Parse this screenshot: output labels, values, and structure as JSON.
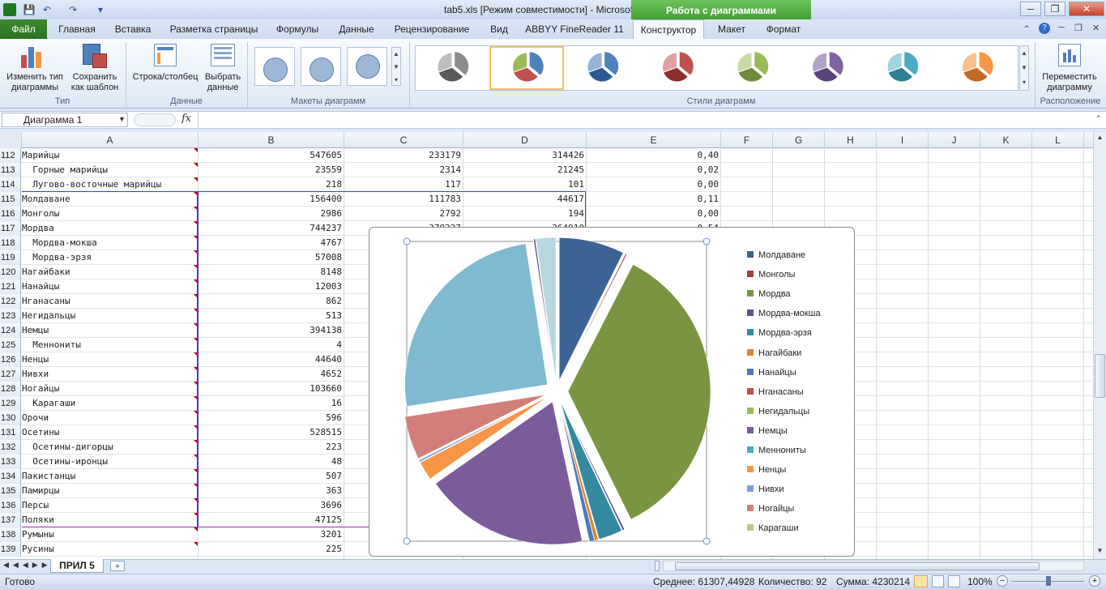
{
  "window": {
    "title": "tab5.xls  [Режим совместимости]  -  Microsoft Excel",
    "context_band": "Работа с диаграммами",
    "win_minimize": "─",
    "win_restore": "❐",
    "win_close": "✕"
  },
  "quick_access": [
    "save-icon",
    "undo-icon",
    "redo-icon",
    "customize-icon"
  ],
  "tabs": {
    "file": "Файл",
    "items": [
      "Главная",
      "Вставка",
      "Разметка страницы",
      "Формулы",
      "Данные",
      "Рецензирование",
      "Вид",
      "ABBYY FineReader 11",
      "Конструктор",
      "Макет",
      "Формат"
    ],
    "active": "Конструктор"
  },
  "ribbon": {
    "change_type": "Изменить тип\nдиаграммы",
    "save_template": "Сохранить\nкак шаблон",
    "group_type": "Тип",
    "row_col": "Строка/столбец",
    "select_data": "Выбрать\nданные",
    "group_data": "Данные",
    "group_layouts": "Макеты диаграмм",
    "group_styles": "Стили диаграмм",
    "move_chart": "Переместить\nдиаграмму",
    "group_location": "Расположение"
  },
  "formula_bar": {
    "name_box": "Диаграмма 1",
    "fx": "fx",
    "formula": ""
  },
  "columns": [
    "A",
    "B",
    "C",
    "D",
    "E",
    "F",
    "G",
    "H",
    "I",
    "J",
    "K",
    "L"
  ],
  "rows": [
    {
      "n": "112",
      "a": "Марийцы",
      "b": "547605",
      "c": "233179",
      "d": "314426",
      "e": "0,40"
    },
    {
      "n": "113",
      "a": "  Горные марийцы",
      "b": "23559",
      "c": "2314",
      "d": "21245",
      "e": "0,02"
    },
    {
      "n": "114",
      "a": "  Лугово-восточные марийцы",
      "b": "218",
      "c": "117",
      "d": "101",
      "e": "0,00"
    },
    {
      "n": "115",
      "a": "Молдаване",
      "b": "156400",
      "c": "111783",
      "d": "44617",
      "e": "0,11"
    },
    {
      "n": "116",
      "a": "Монголы",
      "b": "2986",
      "c": "2792",
      "d": "194",
      "e": "0,00"
    },
    {
      "n": "117",
      "a": "Мордва",
      "b": "744237",
      "c": "379327",
      "d": "364910",
      "e": "0,54"
    },
    {
      "n": "118",
      "a": "  Мордва-мокша",
      "b": "4767",
      "c": "",
      "d": "",
      "e": ""
    },
    {
      "n": "119",
      "a": "  Мордва-эрзя",
      "b": "57008",
      "c": "",
      "d": "",
      "e": ""
    },
    {
      "n": "120",
      "a": "Нагайбаки",
      "b": "8148",
      "c": "",
      "d": "",
      "e": ""
    },
    {
      "n": "121",
      "a": "Нанайцы",
      "b": "12003",
      "c": "",
      "d": "",
      "e": ""
    },
    {
      "n": "122",
      "a": "Нганасаны",
      "b": "862",
      "c": "",
      "d": "",
      "e": ""
    },
    {
      "n": "123",
      "a": "Негидальцы",
      "b": "513",
      "c": "",
      "d": "",
      "e": ""
    },
    {
      "n": "124",
      "a": "Немцы",
      "b": "394138",
      "c": "",
      "d": "",
      "e": ""
    },
    {
      "n": "125",
      "a": "  Меннониты",
      "b": "4",
      "c": "",
      "d": "",
      "e": ""
    },
    {
      "n": "126",
      "a": "Ненцы",
      "b": "44640",
      "c": "",
      "d": "",
      "e": ""
    },
    {
      "n": "127",
      "a": "Нивхи",
      "b": "4652",
      "c": "",
      "d": "",
      "e": ""
    },
    {
      "n": "128",
      "a": "Ногайцы",
      "b": "103660",
      "c": "",
      "d": "",
      "e": ""
    },
    {
      "n": "129",
      "a": "  Карагаши",
      "b": "16",
      "c": "",
      "d": "",
      "e": ""
    },
    {
      "n": "130",
      "a": "Орочи",
      "b": "596",
      "c": "",
      "d": "",
      "e": ""
    },
    {
      "n": "131",
      "a": "Осетины",
      "b": "528515",
      "c": "",
      "d": "",
      "e": ""
    },
    {
      "n": "132",
      "a": "  Осетины-дигорцы",
      "b": "223",
      "c": "",
      "d": "",
      "e": ""
    },
    {
      "n": "133",
      "a": "  Осетины-иронцы",
      "b": "48",
      "c": "",
      "d": "",
      "e": ""
    },
    {
      "n": "134",
      "a": "Пакистанцы",
      "b": "507",
      "c": "",
      "d": "",
      "e": ""
    },
    {
      "n": "135",
      "a": "Памирцы",
      "b": "363",
      "c": "",
      "d": "",
      "e": ""
    },
    {
      "n": "136",
      "a": "Персы",
      "b": "3696",
      "c": "",
      "d": "",
      "e": ""
    },
    {
      "n": "137",
      "a": "Поляки",
      "b": "47125",
      "c": "",
      "d": "",
      "e": ""
    },
    {
      "n": "138",
      "a": "Румыны",
      "b": "3201",
      "c": "",
      "d": "",
      "e": ""
    },
    {
      "n": "139",
      "a": "Русины",
      "b": "225",
      "c": "",
      "d": "",
      "e": ""
    }
  ],
  "chart_data": {
    "type": "pie",
    "exploded": true,
    "categories": [
      "Молдаване",
      "Монголы",
      "Мордва",
      "Мордва-мокша",
      "Мордва-эрзя",
      "Нагайбаки",
      "Нанайцы",
      "Нганасаны",
      "Негидальцы",
      "Немцы",
      "Меннониты",
      "Ненцы",
      "Нивхи",
      "Ногайцы",
      "Карагаши",
      "Орочи",
      "Осетины",
      "Осетины-дигорцы",
      "Осетины-иронцы",
      "Пакистанцы",
      "Памирцы",
      "Персы",
      "Поляки"
    ],
    "values": [
      156400,
      2986,
      744237,
      4767,
      57008,
      8148,
      12003,
      862,
      513,
      394138,
      4,
      44640,
      4652,
      103660,
      16,
      596,
      528515,
      223,
      48,
      507,
      363,
      3696,
      47125
    ],
    "colors": [
      "#3c6394",
      "#9e403c",
      "#7a9542",
      "#684f8c",
      "#338aa0",
      "#dd8335",
      "#4f7ab7",
      "#c0504d",
      "#9bbb59",
      "#7b5c9b",
      "#4bacc6",
      "#f79646",
      "#7f9ed6",
      "#d27f7c",
      "#b3cd84",
      "#a08cbf",
      "#7fbad0",
      "#fab47a",
      "#2f5283",
      "#8c3230",
      "#6e8437",
      "#5a4379",
      "#b8d6e0"
    ],
    "legend_visible": [
      "Молдаване",
      "Монголы",
      "Мордва",
      "Мордва-мокша",
      "Мордва-эрзя",
      "Нагайбаки",
      "Нанайцы",
      "Нганасаны",
      "Негидальцы",
      "Немцы",
      "Меннониты",
      "Ненцы",
      "Нивхи",
      "Ногайцы",
      "Карагаши"
    ],
    "legend_placement": "right"
  },
  "sheet": {
    "tab_name": "ПРИЛ 5"
  },
  "status": {
    "ready": "Готово",
    "average": "Среднее: 61307,44928",
    "count": "Количество: 92",
    "sum": "Сумма: 4230214",
    "zoom": "100%"
  }
}
